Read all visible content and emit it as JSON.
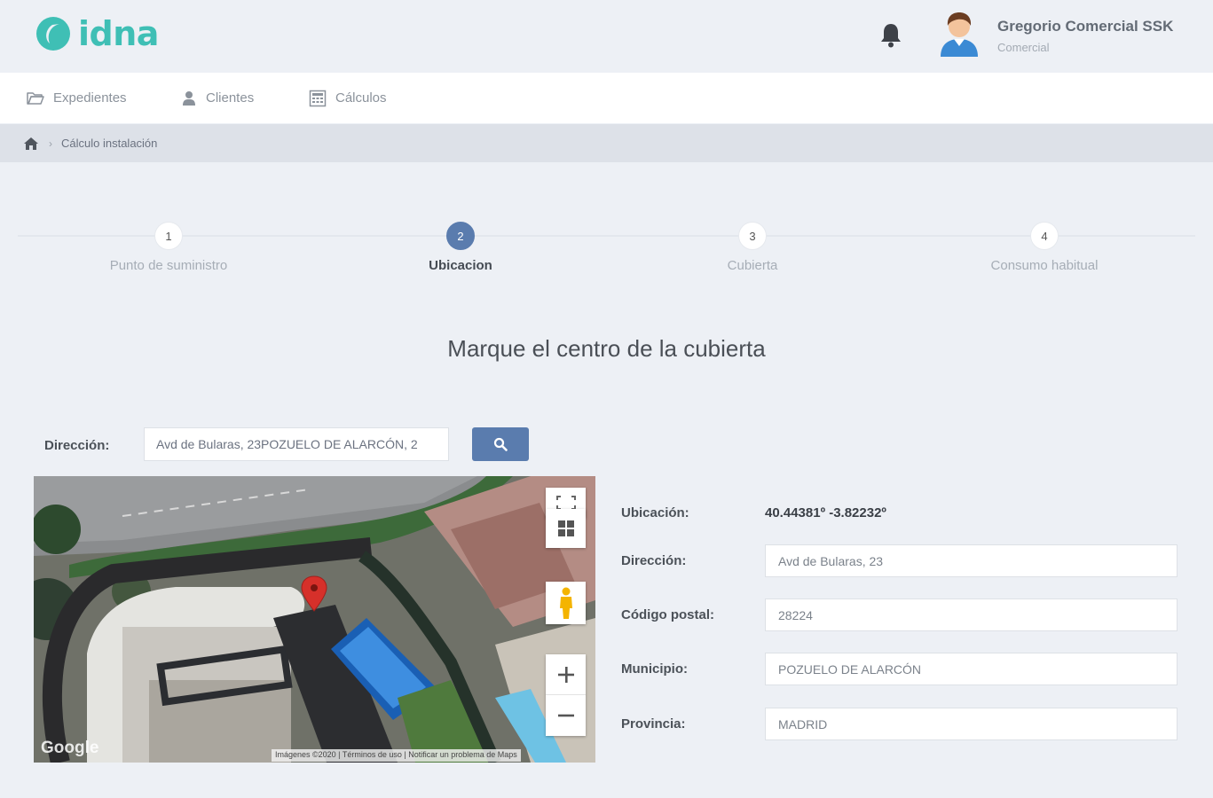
{
  "header": {
    "logo_text": "idna",
    "user_name": "Gregorio Comercial SSK",
    "user_role": "Comercial"
  },
  "nav": {
    "items": [
      {
        "label": "Expedientes",
        "icon": "folder-icon"
      },
      {
        "label": "Clientes",
        "icon": "user-icon"
      },
      {
        "label": "Cálculos",
        "icon": "calculator-icon"
      }
    ]
  },
  "breadcrumb": {
    "home_icon": "home-icon",
    "current": "Cálculo instalación"
  },
  "stepper": {
    "active_step": 2,
    "steps": [
      {
        "number": "1",
        "label": "Punto de suministro"
      },
      {
        "number": "2",
        "label": "Ubicacion"
      },
      {
        "number": "3",
        "label": "Cubierta"
      },
      {
        "number": "4",
        "label": "Consumo habitual"
      }
    ]
  },
  "main": {
    "title": "Marque el centro de la cubierta"
  },
  "search": {
    "label": "Dirección:",
    "value": "Avd de Bularas, 23POZUELO DE ALARCÓN, 2"
  },
  "map": {
    "credit": "Imágenes ©2020 | Términos de uso | Notificar un problema de Maps",
    "logo": "Google"
  },
  "details": {
    "location_label": "Ubicación:",
    "location_value": "40.44381º -3.82232º",
    "address_label": "Dirección:",
    "address_value": "Avd de Bularas, 23",
    "postal_label": "Código postal:",
    "postal_value": "28224",
    "municipality_label": "Municipio:",
    "municipality_value": "POZUELO DE ALARCÓN",
    "province_label": "Provincia:",
    "province_value": "MADRID"
  },
  "colors": {
    "brand": "#3fbfb5",
    "accent": "#5a7cae",
    "background": "#edf0f5"
  }
}
